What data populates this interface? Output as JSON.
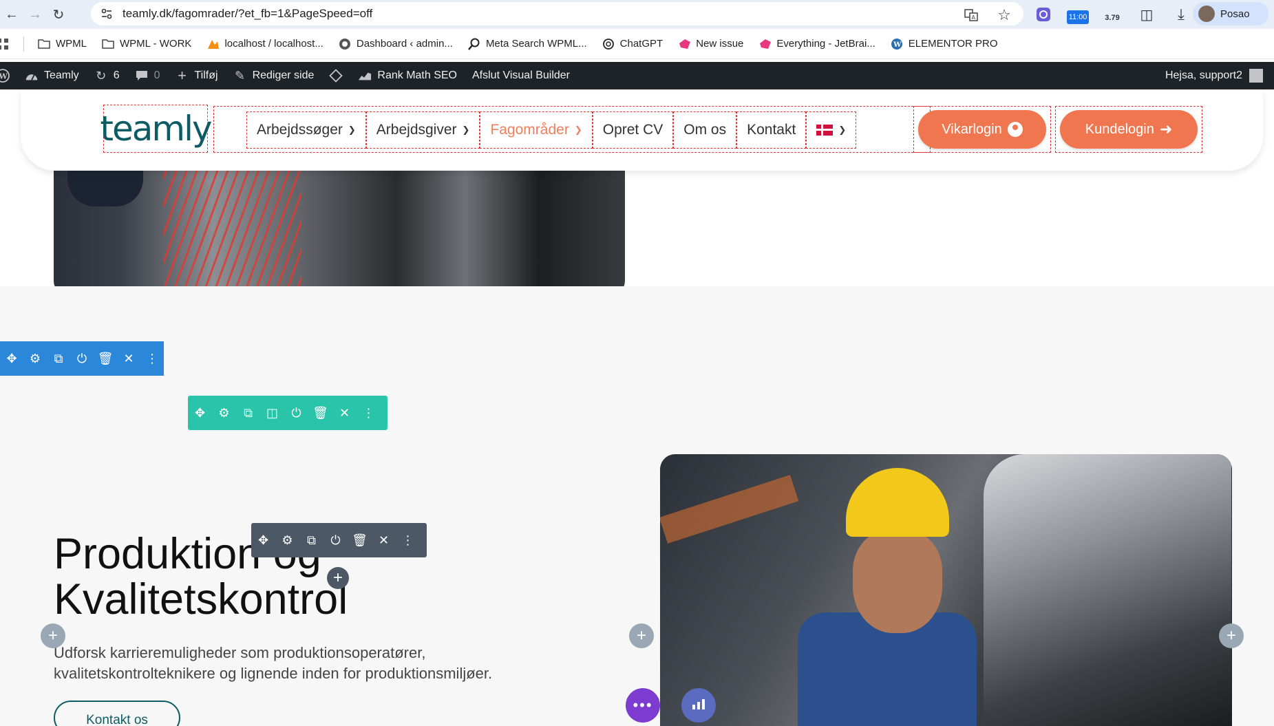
{
  "browser": {
    "url": "teamly.dk/fagomrader/?et_fb=1&PageSpeed=off",
    "profile_name": "Posao",
    "ext_clock": "11:00",
    "ext_speed": "3.79"
  },
  "bookmarks": [
    {
      "label": "WPML",
      "icon": "folder-icon"
    },
    {
      "label": "WPML - WORK",
      "icon": "folder-icon"
    },
    {
      "label": "localhost / localhost...",
      "icon": "phpmyadmin-icon"
    },
    {
      "label": "Dashboard ‹ admin...",
      "icon": "globe-icon"
    },
    {
      "label": "Meta Search WPML...",
      "icon": "search-icon"
    },
    {
      "label": "ChatGPT",
      "icon": "chatgpt-icon"
    },
    {
      "label": "New issue",
      "icon": "jetbrains-icon"
    },
    {
      "label": "Everything - JetBrai...",
      "icon": "jetbrains-icon"
    },
    {
      "label": "ELEMENTOR PRO",
      "icon": "wordpress-icon"
    }
  ],
  "wpbar": {
    "site_name": "Teamly",
    "updates_count": "6",
    "comments_count": "0",
    "add_new": "Tilføj",
    "edit_page": "Rediger side",
    "rank_math": "Rank Math SEO",
    "exit_builder": "Afslut Visual Builder",
    "greeting": "Hejsa, support2"
  },
  "header": {
    "logo_text": "teamly",
    "menu": [
      {
        "label": "Arbejdssøger",
        "dropdown": true
      },
      {
        "label": "Arbejdsgiver",
        "dropdown": true
      },
      {
        "label": "Fagområder",
        "dropdown": true,
        "active": true
      },
      {
        "label": "Opret CV",
        "dropdown": false
      },
      {
        "label": "Om os",
        "dropdown": false
      },
      {
        "label": "Kontakt",
        "dropdown": false
      }
    ],
    "vikar_login": "Vikarlogin",
    "kunde_login": "Kundelogin"
  },
  "section": {
    "title_line1": "Produktion og",
    "title_line2": "Kvalitetskontrol",
    "description": "Udforsk karrieremuligheder som produktionsoperatører, kvalitetskontrolteknikere og lignende inden for produktionsmiljøer.",
    "button": "Kontakt os"
  },
  "colors": {
    "accent_orange": "#f0764f",
    "brand_teal": "#0e5c63",
    "toolbar_blue": "#2b87da",
    "toolbar_green": "#29c4a9",
    "toolbar_dark": "#4c5866"
  }
}
